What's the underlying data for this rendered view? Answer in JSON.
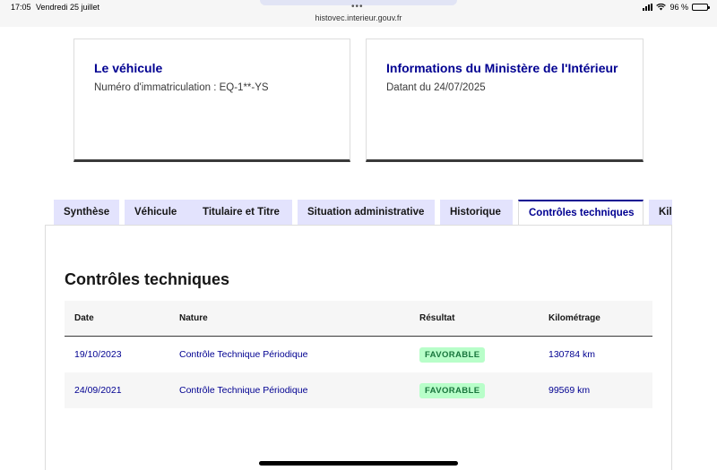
{
  "status_bar": {
    "time": "17:05",
    "date": "Vendredi 25 juillet",
    "url": "histovec.interieur.gouv.fr",
    "battery": "96 %",
    "battery_level": 0.96
  },
  "cards": {
    "vehicle": {
      "title": "Le véhicule",
      "text": "Numéro d'immatriculation : EQ-1**-YS"
    },
    "ministry": {
      "title": "Informations du Ministère de l'Intérieur",
      "text": "Datant du 24/07/2025"
    }
  },
  "tabs": [
    {
      "label": "Synthèse"
    },
    {
      "label": "Véhicule"
    },
    {
      "label": "Titulaire et Titre"
    },
    {
      "label": "Situation administrative"
    },
    {
      "label": "Historique"
    },
    {
      "label": "Contrôles techniques",
      "active": true
    },
    {
      "label": "Kil"
    }
  ],
  "section": {
    "title": "Contrôles techniques",
    "columns": [
      "Date",
      "Nature",
      "Résultat",
      "Kilométrage"
    ],
    "rows": [
      {
        "date": "19/10/2023",
        "nature": "Contrôle Technique Périodique",
        "result": "FAVORABLE",
        "km": "130784 km"
      },
      {
        "date": "24/09/2021",
        "nature": "Contrôle Technique Périodique",
        "result": "FAVORABLE",
        "km": "99569 km"
      }
    ]
  },
  "colors": {
    "accent": "#000091",
    "tab_bg": "#e3e3fd",
    "badge_bg": "#b8fec9",
    "badge_text": "#18753c"
  }
}
